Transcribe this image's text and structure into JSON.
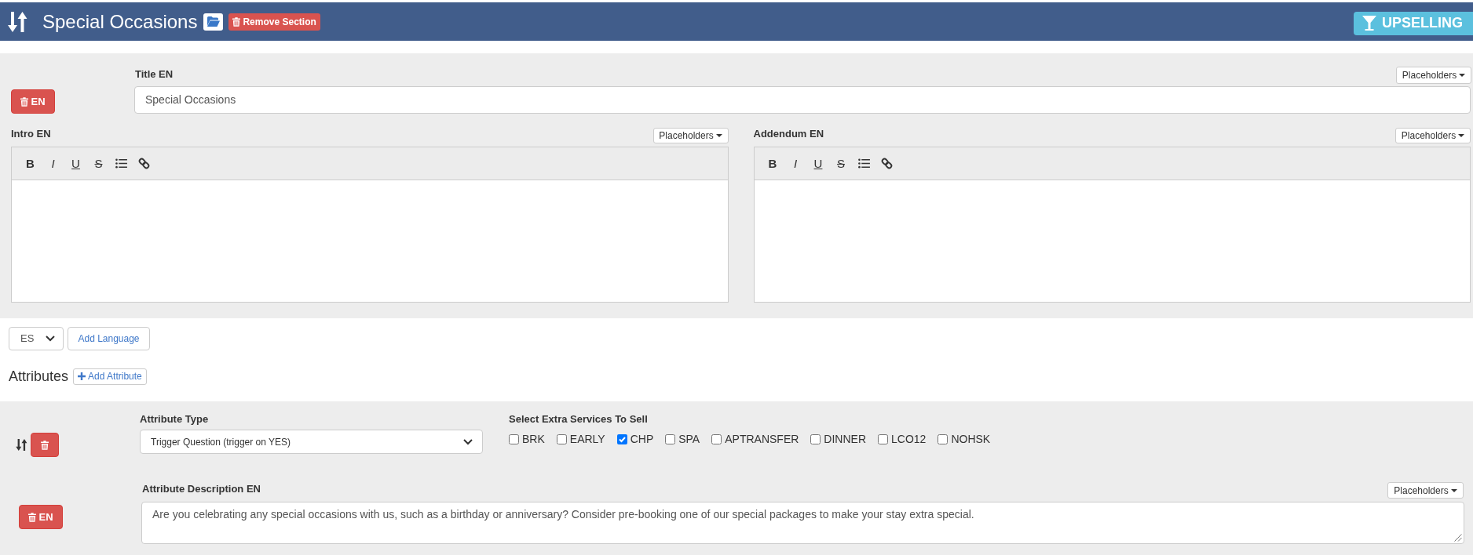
{
  "header": {
    "title": "Special Occasions",
    "remove_button": "Remove Section",
    "badge": "UPSELLING"
  },
  "title_row": {
    "delete_button": "EN",
    "label": "Title EN",
    "placeholders_button": "Placeholders",
    "value": "Special Occasions"
  },
  "editors": [
    {
      "label": "Intro EN",
      "placeholders_button": "Placeholders",
      "toolbar": [
        {
          "kind": "bold",
          "text": "B"
        },
        {
          "kind": "italic",
          "text": "I"
        },
        {
          "kind": "underline",
          "text": "U"
        },
        {
          "kind": "strike",
          "text": "S"
        },
        {
          "kind": "list"
        },
        {
          "kind": "link"
        }
      ]
    },
    {
      "label": "Addendum EN",
      "placeholders_button": "Placeholders",
      "toolbar": [
        {
          "kind": "bold",
          "text": "B"
        },
        {
          "kind": "italic",
          "text": "I"
        },
        {
          "kind": "underline",
          "text": "U"
        },
        {
          "kind": "strike",
          "text": "S"
        },
        {
          "kind": "list"
        },
        {
          "kind": "link"
        }
      ]
    }
  ],
  "language": {
    "select_value": "ES",
    "add_button": "Add Language"
  },
  "attributes": {
    "heading": "Attributes",
    "add_button": "Add Attribute",
    "items": [
      {
        "type_label": "Attribute Type",
        "type_value": "Trigger Question (trigger on YES)",
        "services_label": "Select Extra Services To Sell",
        "services": [
          {
            "label": "BRK",
            "checked": false
          },
          {
            "label": "EARLY",
            "checked": false
          },
          {
            "label": "CHP",
            "checked": true
          },
          {
            "label": "SPA",
            "checked": false
          },
          {
            "label": "APTRANSFER",
            "checked": false
          },
          {
            "label": "DINNER",
            "checked": false
          },
          {
            "label": "LCO12",
            "checked": false
          },
          {
            "label": "NOHSK",
            "checked": false
          }
        ],
        "description": {
          "label": "Attribute Description EN",
          "delete_button": "EN",
          "placeholders_button": "Placeholders",
          "value": "Are you celebrating any special occasions with us, such as a birthday or anniversary? Consider pre-booking one of our special packages to make your stay extra special."
        }
      }
    ]
  }
}
